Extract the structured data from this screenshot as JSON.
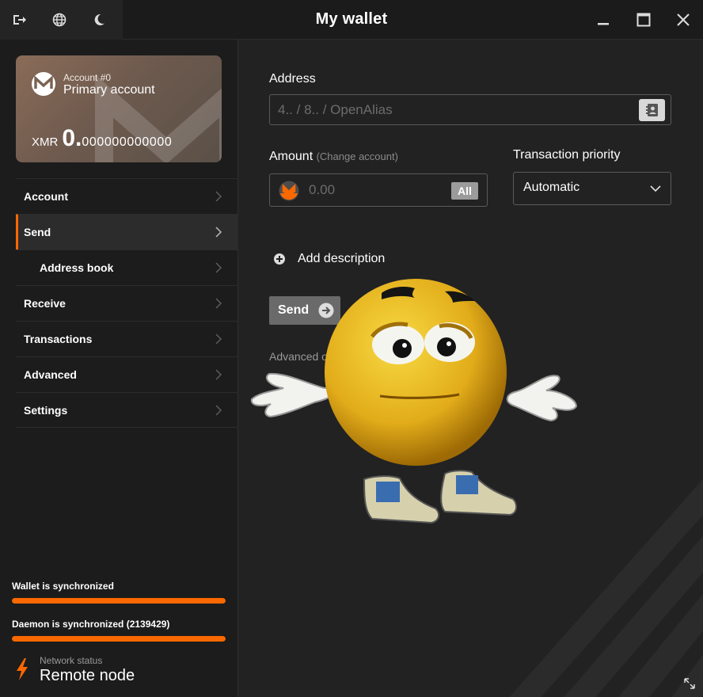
{
  "window": {
    "title": "My wallet"
  },
  "titlebar": {
    "left_icons": [
      "logout-icon",
      "globe-icon",
      "moon-icon"
    ],
    "right_icons": [
      "minimize-icon",
      "maximize-icon",
      "close-icon"
    ]
  },
  "account_card": {
    "number_label": "Account #0",
    "name": "Primary account",
    "currency": "XMR",
    "balance_int": "0.",
    "balance_dec": "000000000000"
  },
  "sidebar": {
    "items": [
      {
        "label": "Account"
      },
      {
        "label": "Send",
        "active": true
      },
      {
        "label": "Address book",
        "sub": true
      },
      {
        "label": "Receive"
      },
      {
        "label": "Transactions"
      },
      {
        "label": "Advanced"
      },
      {
        "label": "Settings"
      }
    ],
    "wallet_sync": {
      "label": "Wallet is synchronized",
      "progress": 1.0
    },
    "daemon_sync": {
      "label": "Daemon is synchronized (2139429)",
      "progress": 1.0
    },
    "network": {
      "label": "Network status",
      "value": "Remote node"
    }
  },
  "send_form": {
    "address_label": "Address",
    "address_placeholder": "4.. / 8.. / OpenAlias",
    "amount_label": "Amount",
    "amount_hint": "(Change account)",
    "amount_placeholder": "0.00",
    "all_button": "All",
    "priority_label": "Transaction priority",
    "priority_value": "Automatic",
    "add_description": "Add description",
    "send_button": "Send",
    "advanced_options": "Advanced o"
  },
  "colors": {
    "accent": "#fa6800",
    "card": "#7a6252",
    "background": "#222222"
  }
}
